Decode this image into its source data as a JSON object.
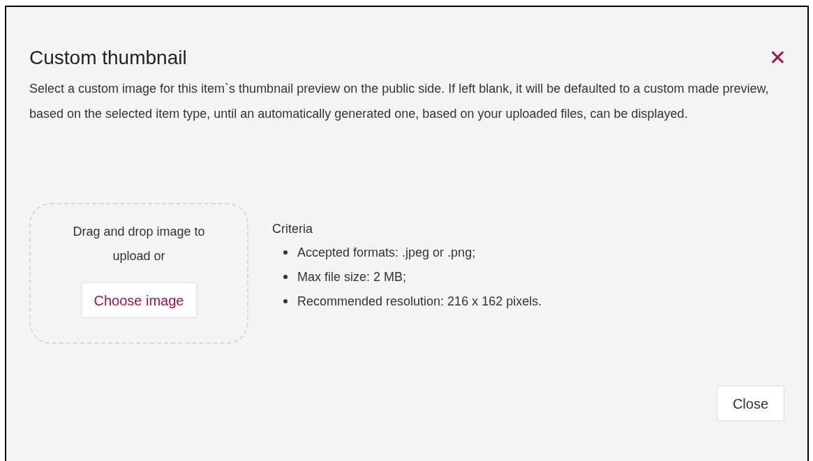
{
  "dialog": {
    "title": "Custom thumbnail",
    "close_icon": "✕",
    "description": "Select a custom image for this item`s thumbnail preview on the public side. If left blank, it will be defaulted to a custom made preview, based on the selected item type, until an automatically generated one, based on your uploaded files, can be displayed."
  },
  "dropzone": {
    "prompt": "Drag and drop image to upload or",
    "button": "Choose image"
  },
  "criteria": {
    "heading": "Criteria",
    "items": [
      "Accepted formats: .jpeg or .png;",
      "Max file size: 2 MB;",
      "Recommended resolution: 216 x 162 pixels."
    ]
  },
  "footer": {
    "button": "Close"
  }
}
